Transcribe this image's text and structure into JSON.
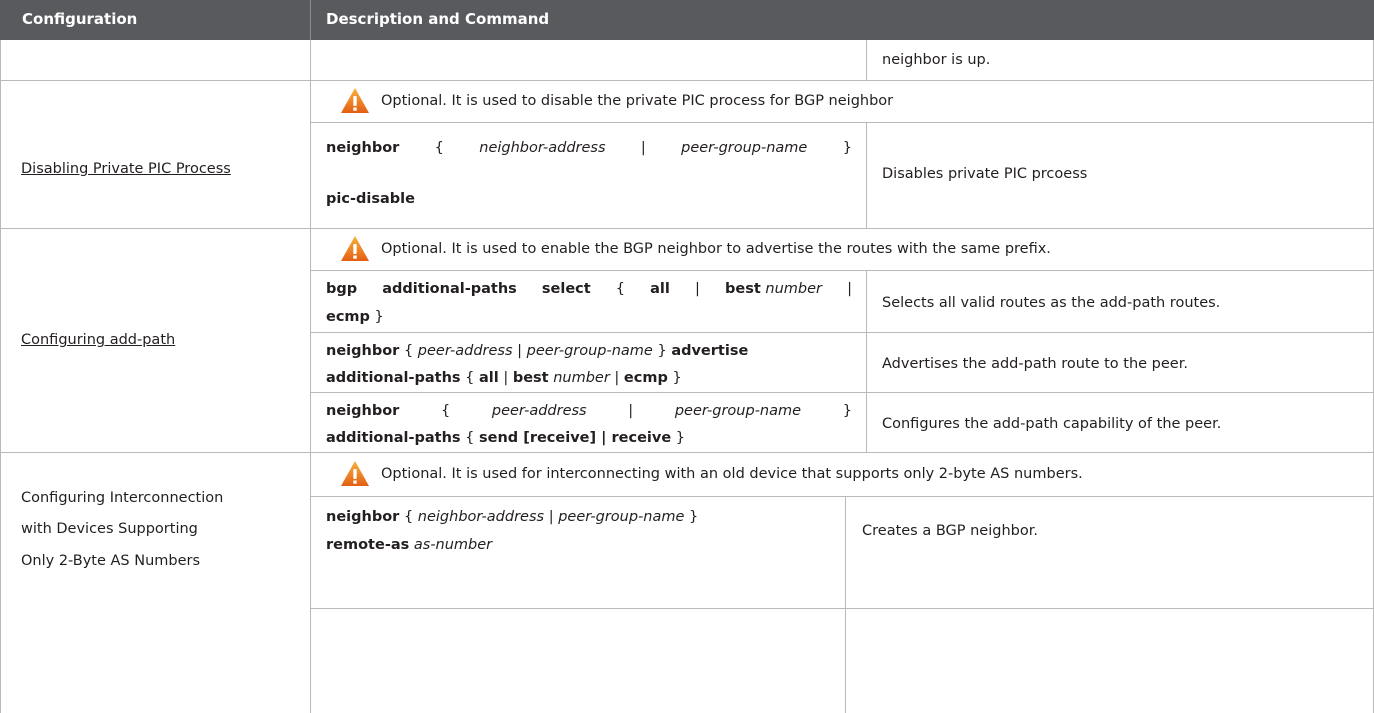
{
  "header": {
    "col1": "Configuration",
    "col2": "Description and Command"
  },
  "row0": {
    "desc": "neighbor is up."
  },
  "pic": {
    "config_link": "Disabling Private PIC Process",
    "note": "Optional. It is used to disable the private PIC process for BGP neighbor",
    "cmd": {
      "neighbor": "neighbor",
      "lb": "{",
      "addr": "neighbor-address",
      "bar": "|",
      "pg": "peer-group-name",
      "rb": "}",
      "tail": "pic-disable"
    },
    "desc": "Disables private PIC prcoess"
  },
  "addpath": {
    "config_link": "Configuring add-path",
    "note": "Optional. It is used to enable the BGP neighbor to advertise the routes with the same prefix.",
    "c1": {
      "kw": "bgp",
      "kw2": "additional-paths",
      "kw3": "select",
      "lb": "{",
      "all": "all",
      "bar": "|",
      "best": "best",
      "number": "number",
      "bar2": "|",
      "ecmp": "ecmp",
      "rb": "}",
      "desc": "Selects all valid routes as the add-path routes."
    },
    "c2": {
      "neighbor": "neighbor",
      "lb": "{",
      "peer": "peer-address",
      "bar": "|",
      "pg": "peer-group-name",
      "rb": "}",
      "adv": "advertise",
      "ap": "additional-paths",
      "lb2": "{",
      "all": "all",
      "bar2": "|",
      "best": "best",
      "number": "number",
      "bar3": "|",
      "ecmp": "ecmp",
      "rb2": "}",
      "desc": "Advertises the add-path route to the peer."
    },
    "c3": {
      "neighbor": "neighbor",
      "lb": "{",
      "peer": "peer-address",
      "bar": "|",
      "pg": "peer-group-name",
      "rb": "}",
      "ap": "additional-paths",
      "lb2": "{",
      "send": "send [receive] | receive",
      "rb2": "}",
      "desc": "Configures the add-path capability of the peer."
    }
  },
  "interconn": {
    "config_line1": "Configuring Interconnection",
    "config_line2": "with Devices Supporting",
    "config_line3": "Only 2-Byte AS Numbers",
    "note": "Optional. It is used for interconnecting with an old device that supports only 2-byte AS numbers.",
    "cmd": {
      "neighbor": "neighbor",
      "lb": "{",
      "addr": "neighbor-address",
      "bar": "|",
      "pg": "peer-group-name",
      "rb": "}",
      "ras": "remote-as",
      "asn": "as-number"
    },
    "desc": "Creates a BGP neighbor."
  }
}
